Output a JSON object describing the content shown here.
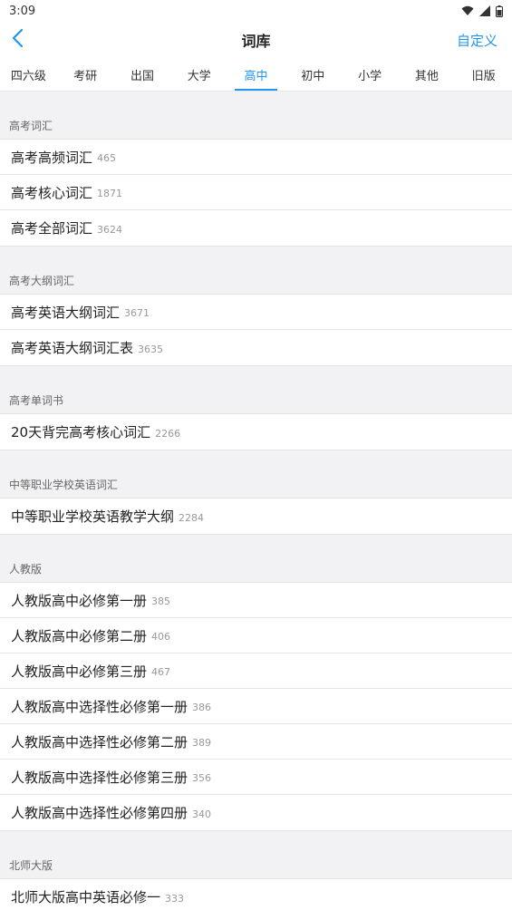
{
  "status": {
    "time": "3:09"
  },
  "nav": {
    "title": "词库",
    "custom_label": "自定义"
  },
  "tabs": [
    {
      "label": "四六级"
    },
    {
      "label": "考研"
    },
    {
      "label": "出国"
    },
    {
      "label": "大学"
    },
    {
      "label": "高中",
      "active": true
    },
    {
      "label": "初中"
    },
    {
      "label": "小学"
    },
    {
      "label": "其他"
    },
    {
      "label": "旧版"
    }
  ],
  "sections": [
    {
      "title": "高考词汇",
      "items": [
        {
          "label": "高考高频词汇",
          "count": "465"
        },
        {
          "label": "高考核心词汇",
          "count": "1871"
        },
        {
          "label": "高考全部词汇",
          "count": "3624"
        }
      ]
    },
    {
      "title": "高考大纲词汇",
      "items": [
        {
          "label": "高考英语大纲词汇",
          "count": "3671"
        },
        {
          "label": "高考英语大纲词汇表",
          "count": "3635"
        }
      ]
    },
    {
      "title": "高考单词书",
      "items": [
        {
          "label": "20天背完高考核心词汇",
          "count": "2266"
        }
      ]
    },
    {
      "title": "中等职业学校英语词汇",
      "items": [
        {
          "label": "中等职业学校英语教学大纲",
          "count": "2284"
        }
      ]
    },
    {
      "title": "人教版",
      "items": [
        {
          "label": "人教版高中必修第一册",
          "count": "385"
        },
        {
          "label": "人教版高中必修第二册",
          "count": "406"
        },
        {
          "label": "人教版高中必修第三册",
          "count": "467"
        },
        {
          "label": "人教版高中选择性必修第一册",
          "count": "386"
        },
        {
          "label": "人教版高中选择性必修第二册",
          "count": "389"
        },
        {
          "label": "人教版高中选择性必修第三册",
          "count": "356"
        },
        {
          "label": "人教版高中选择性必修第四册",
          "count": "340"
        }
      ]
    },
    {
      "title": "北师大版",
      "items": [
        {
          "label": "北师大版高中英语必修一",
          "count": "333"
        }
      ]
    }
  ],
  "colors": {
    "accent": "#2196f3"
  }
}
